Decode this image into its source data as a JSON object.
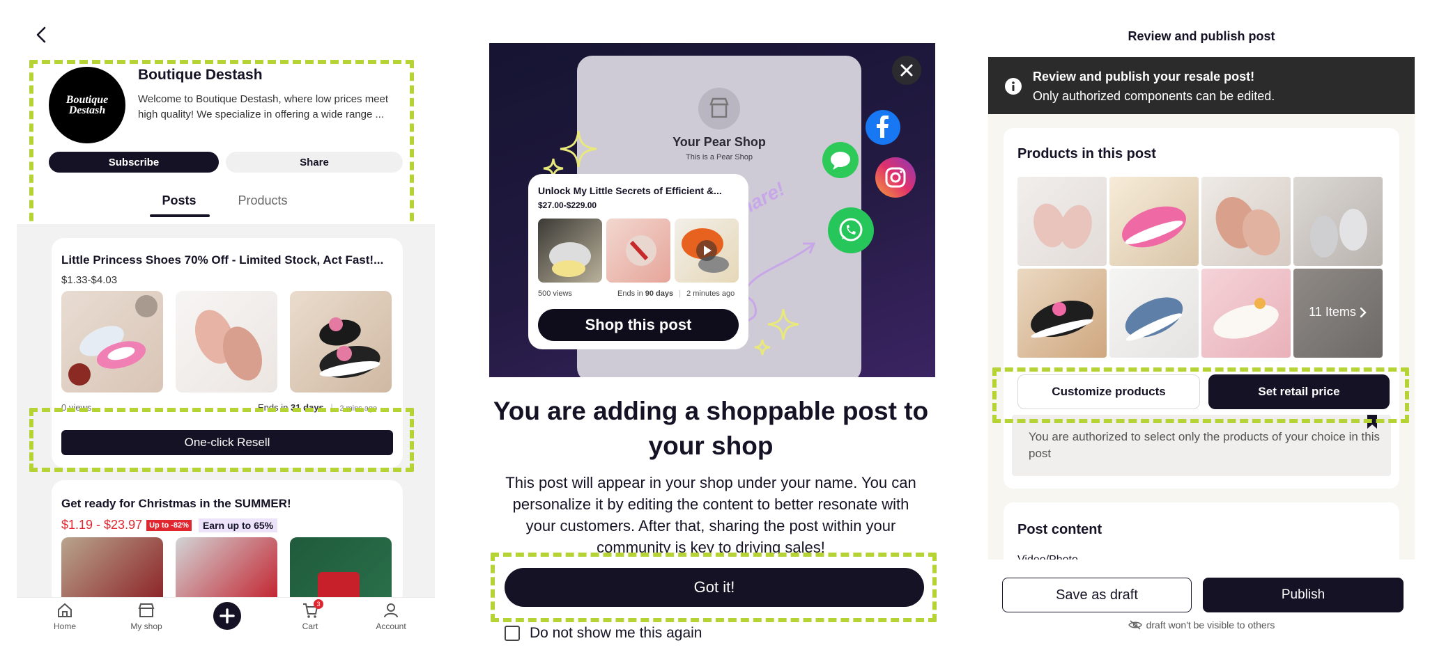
{
  "shop": {
    "name": "Boutique Destash",
    "logo_text": "Boutique Destash",
    "description": "Welcome to Boutique Destash, where low prices meet high quality! We specialize in offering a wide range ...",
    "subscribe_label": "Subscribe",
    "share_label": "Share",
    "tabs": [
      "Posts",
      "Products"
    ],
    "active_tab": "Posts"
  },
  "posts": [
    {
      "title": "Little Princess Shoes 70% Off - Limited Stock, Act Fast!...",
      "price": "$1.33-$4.03",
      "views": "0 views",
      "ends_prefix": "Ends in",
      "ends_days": "31 days",
      "time_ago": "2 mins ago",
      "resell_label": "One-click Resell"
    },
    {
      "title": "Get ready for Christmas in the SUMMER!",
      "price": "$1.19 - $23.97",
      "discount_badge": "Up to -82%",
      "earn_badge": "Earn up to 65%"
    }
  ],
  "bottom_nav": {
    "items": [
      "Home",
      "My shop",
      "",
      "Cart",
      "Account"
    ],
    "cart_count": "3"
  },
  "modal": {
    "shop_title": "Your Pear Shop",
    "shop_subtitle": "This is a Pear Shop",
    "card_title": "Unlock My Little Secrets of Efficient &...",
    "card_price": "$27.00-$229.00",
    "card_views": "500 views",
    "card_ends_prefix": "Ends in",
    "card_ends_days": "90 days",
    "card_time": "2 minutes ago",
    "shop_post_label": "Shop this post",
    "share_word": "Share!",
    "title": "You are adding a shoppable post to your shop",
    "body": "This post will appear in your shop under your name. You can personalize it by editing the content to better resonate with your customers. After that, sharing the post within your community is key to driving sales!",
    "got_it_label": "Got it!",
    "dont_show_label": "Do not show me this again"
  },
  "review": {
    "header": "Review and publish post",
    "banner_line1": "Review and publish your resale post!",
    "banner_line2": "Only authorized components can be edited.",
    "products_heading": "Products in this post",
    "items_count_label": "11 Items",
    "customize_label": "Customize products",
    "set_price_label": "Set retail price",
    "authorized_note": "You are authorized to select only the products of your choice in this post",
    "post_content_heading": "Post content",
    "video_photo_label": "Video/Photo",
    "save_draft_label": "Save as draft",
    "publish_label": "Publish",
    "draft_note": "draft won't be visible to others"
  },
  "colors": {
    "dark_navy": "#141224",
    "highlight_green": "#b5d334",
    "price_red": "#e0262f",
    "earn_purple": "#ece3fb",
    "banner_dark": "#2b2b2b",
    "facebook": "#1877f2",
    "whatsapp": "#27c65a"
  },
  "icons": [
    "back-chevron-icon",
    "home-icon",
    "shop-icon",
    "plus-icon",
    "cart-icon",
    "account-icon",
    "close-icon",
    "store-icon",
    "facebook-icon",
    "instagram-icon",
    "whatsapp-icon",
    "message-icon",
    "sparkle-icon",
    "play-icon",
    "info-icon",
    "chevron-right-icon",
    "bookmark-icon",
    "eye-off-icon",
    "checkbox-icon"
  ]
}
